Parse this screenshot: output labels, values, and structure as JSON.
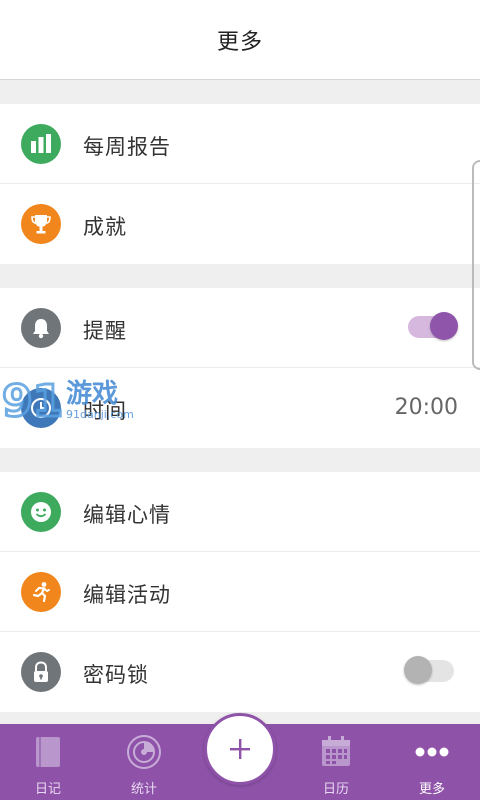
{
  "header": {
    "title": "更多"
  },
  "groups": [
    {
      "items": [
        {
          "label": "每周报告",
          "icon": "bar-chart-icon",
          "color": "#3daa5e"
        },
        {
          "label": "成就",
          "icon": "trophy-icon",
          "color": "#f0861c"
        }
      ]
    },
    {
      "items": [
        {
          "label": "提醒",
          "icon": "bell-icon",
          "color": "#6f7579",
          "toggle": true
        },
        {
          "label": "时间",
          "icon": "clock-icon",
          "value": "20:00"
        }
      ]
    },
    {
      "items": [
        {
          "label": "编辑心情",
          "icon": "smiley-icon",
          "color": "#3daa5e"
        },
        {
          "label": "编辑活动",
          "icon": "runner-icon",
          "color": "#f0861c"
        },
        {
          "label": "密码锁",
          "icon": "lock-icon",
          "color": "#6f7579",
          "toggle": false
        }
      ]
    }
  ],
  "watermark": {
    "brand": "游戏",
    "site": "91danji.com",
    "number": "91"
  },
  "bottom_nav": {
    "items": [
      {
        "label": "日记",
        "icon": "book-icon"
      },
      {
        "label": "统计",
        "icon": "disc-chart-icon"
      },
      {
        "label": "日历",
        "icon": "calendar-icon"
      },
      {
        "label": "更多",
        "icon": "more-dots-icon",
        "active": true
      }
    ],
    "fab_label": "+"
  },
  "colors": {
    "accent": "#8e52a9",
    "toggle_on": "#8e55aa",
    "background": "#efefef"
  }
}
